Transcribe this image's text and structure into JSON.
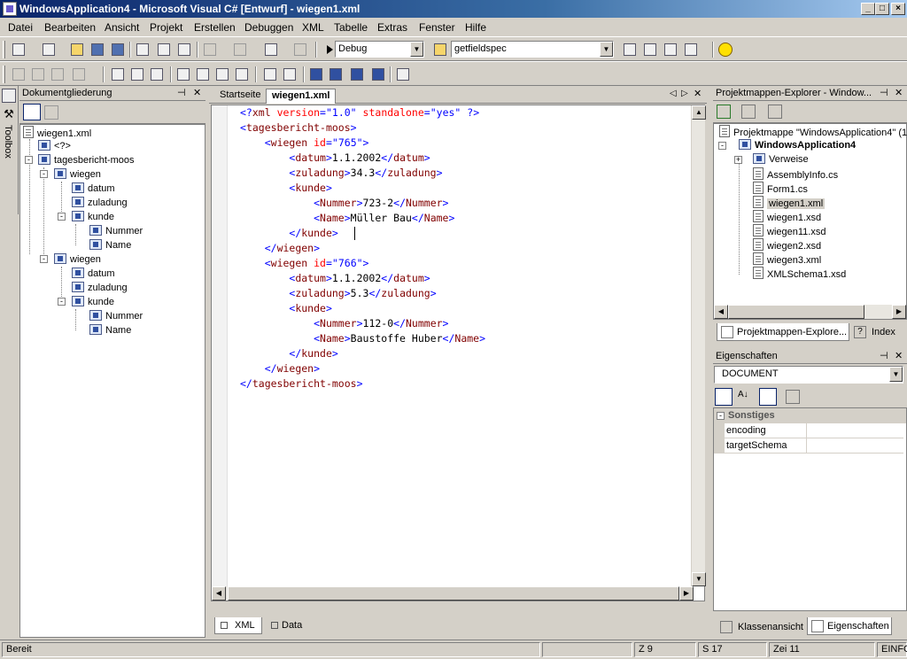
{
  "window": {
    "title": "WindowsApplication4 - Microsoft Visual C# [Entwurf] - wiegen1.xml",
    "controls": [
      "_",
      "□",
      "×"
    ]
  },
  "menu": [
    "Datei",
    "Bearbeiten",
    "Ansicht",
    "Projekt",
    "Erstellen",
    "Debuggen",
    "XML",
    "Tabelle",
    "Extras",
    "Fenster",
    "Hilfe"
  ],
  "toolbar": {
    "config_combo": "Debug",
    "find_combo": "getfieldspec"
  },
  "toolbox": {
    "label": "Toolbox"
  },
  "outline": {
    "title": "Dokumentgliederung",
    "items": [
      "wiegen1.xml",
      "<?>",
      "tagesbericht-moos",
      "wiegen",
      "datum",
      "zuladung",
      "kunde",
      "Nummer",
      "Name",
      "wiegen",
      "datum",
      "zuladung",
      "kunde",
      "Nummer",
      "Name"
    ]
  },
  "editor": {
    "tabs": [
      "Startseite",
      "wiegen1.xml"
    ],
    "lines": [
      "<?xml version=\"1.0\" standalone=\"yes\" ?>",
      "<tagesbericht-moos>",
      "    <wiegen id=\"765\">",
      "        <datum>1.1.2002</datum>",
      "        <zuladung>34.3</zuladung>",
      "        <kunde>",
      "            <Nummer>723-2</Nummer>",
      "            <Name>Müller Bau</Name>",
      "        </kunde>",
      "    </wiegen>",
      "    <wiegen id=\"766\">",
      "        <datum>1.1.2002</datum>",
      "        <zuladung>5.3</zuladung>",
      "        <kunde>",
      "            <Nummer>112-0</Nummer>",
      "            <Name>Baustoffe Huber</Name>",
      "        </kunde>",
      "    </wiegen>",
      "</tagesbericht-moos>"
    ],
    "view_tabs": [
      "XML",
      "Data"
    ]
  },
  "solution_explorer": {
    "title": "Projektmappen-Explorer - Window...",
    "items": [
      "Projektmappe \"WindowsApplication4\" (1",
      "WindowsApplication4",
      "Verweise",
      "AssemblyInfo.cs",
      "Form1.cs",
      "wiegen1.xml",
      "wiegen1.xsd",
      "wiegen11.xsd",
      "wiegen2.xsd",
      "wiegen3.xml",
      "XMLSchema1.xsd"
    ],
    "tabs": [
      "Projektmappen-Explore...",
      "Index"
    ]
  },
  "properties": {
    "title": "Eigenschaften",
    "object": "DOCUMENT",
    "category": "Sonstiges",
    "rows": [
      "encoding",
      "targetSchema"
    ],
    "tabs": [
      "Klassenansicht",
      "Eigenschaften"
    ]
  },
  "status": {
    "message": "Bereit",
    "line": "Z 9",
    "col": "S 17",
    "char": "Zei 11",
    "mode": "EINFG"
  }
}
